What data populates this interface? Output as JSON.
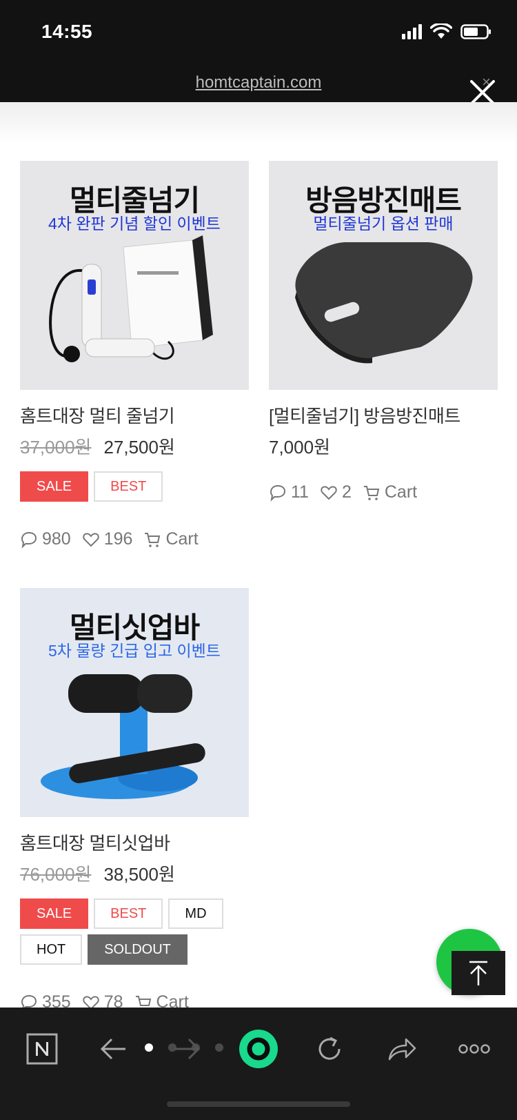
{
  "status_bar": {
    "time": "14:55"
  },
  "browser": {
    "url": "homtcaptain.com",
    "close_label": "×"
  },
  "products": [
    {
      "image_title": "멀티줄넘기",
      "image_subtitle": "4차 완판 기념 할인 이벤트",
      "name": "홈트대장 멀티 줄넘기",
      "old_price": "37,000원",
      "price": "27,500원",
      "badges": [
        "SALE",
        "BEST"
      ],
      "comments": "980",
      "likes": "196",
      "cart_label": "Cart"
    },
    {
      "image_title": "방음방진매트",
      "image_subtitle": "멀티줄넘기 옵션 판매",
      "name": "[멀티줄넘기] 방음방진매트",
      "price": "7,000원",
      "badges": [],
      "comments": "11",
      "likes": "2",
      "cart_label": "Cart"
    },
    {
      "image_title": "멀티싯업바",
      "image_subtitle": "5차 물량 긴급 입고 이벤트",
      "name": "홈트대장 멀티싯업바",
      "old_price": "76,000원",
      "price": "38,500원",
      "badges": [
        "SALE",
        "BEST",
        "MD",
        "HOT",
        "SOLDOUT"
      ],
      "comments": "355",
      "likes": "78",
      "cart_label": "Cart"
    }
  ],
  "toolbar": {
    "items": [
      "naver-icon",
      "back-icon",
      "forward-icon",
      "home-icon",
      "refresh-icon",
      "share-icon",
      "more-icon"
    ]
  },
  "colors": {
    "sale": "#f04b4b",
    "fab": "#1ec543",
    "toolbar_accent": "#19d98c"
  }
}
